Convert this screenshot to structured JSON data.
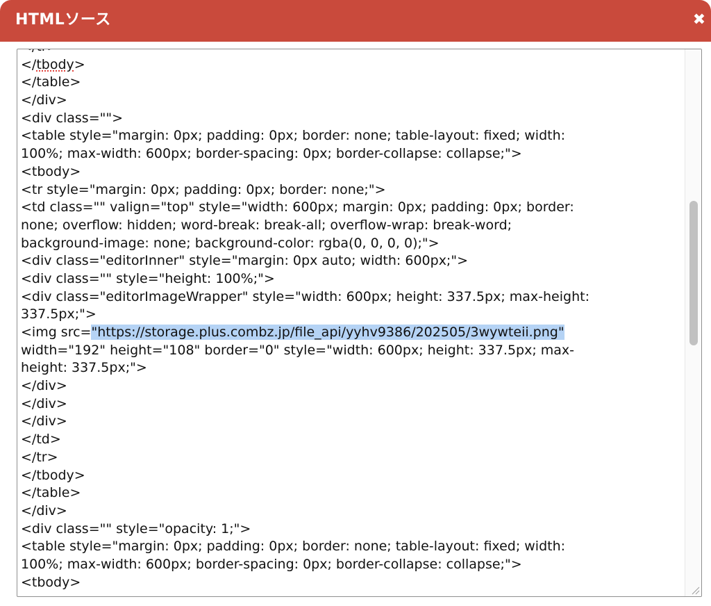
{
  "dialog": {
    "title": "HTMLソース",
    "close_icon": "close-icon",
    "title_bar_color": "#c94a3c"
  },
  "editor": {
    "selected_text": "\"https://storage.plus.combz.jp/file_api/yyhv9386/202505/3wywteii.png\"",
    "lines": [
      "</tr>",
      "</tbody>",
      "</table>",
      "</div>",
      "<div class=\"\">",
      "<table style=\"margin: 0px; padding: 0px; border: none; table-layout: fixed; width:",
      "100%; max-width: 600px; border-spacing: 0px; border-collapse: collapse;\">",
      "<tbody>",
      "<tr style=\"margin: 0px; padding: 0px; border: none;\">",
      "<td class=\"\" valign=\"top\" style=\"width: 600px; margin: 0px; padding: 0px; border:",
      "none; overflow: hidden; word-break: break-all; overflow-wrap: break-word;",
      "background-image: none; background-color: rgba(0, 0, 0, 0);\">",
      "<div class=\"editorInner\" style=\"margin: 0px auto; width: 600px;\">",
      "<div class=\"\" style=\"height: 100%;\">",
      "<div class=\"editorImageWrapper\" style=\"width: 600px; height: 337.5px; max-height:",
      "337.5px;\">",
      "<img src=",
      "width=\"192\" height=\"108\" border=\"0\" style=\"width: 600px; height: 337.5px; max-",
      "height: 337.5px;\">",
      "</div>",
      "</div>",
      "</div>",
      "</td>",
      "</tr>",
      "</tbody>",
      "</table>",
      "</div>",
      "<div class=\"\" style=\"opacity: 1;\">",
      "<table style=\"margin: 0px; padding: 0px; border: none; table-layout: fixed; width:",
      "100%; max-width: 600px; border-spacing: 0px; border-collapse: collapse;\">",
      "<tbody>"
    ]
  }
}
